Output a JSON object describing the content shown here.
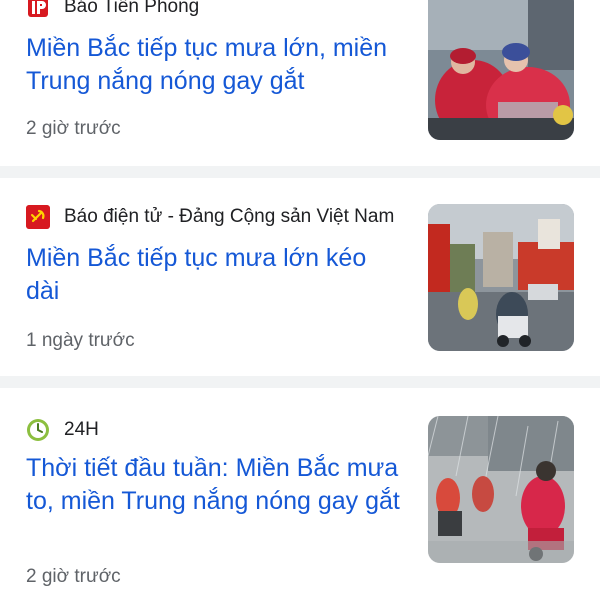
{
  "articles": [
    {
      "source": "Báo Tiền Phong",
      "title": "Miền Bắc tiếp tục mưa lớn, miền Trung nắng nóng gay gắt",
      "time": "2 giờ trước"
    },
    {
      "source": "Báo điện tử - Đảng Cộng sản Việt Nam",
      "title": "Miền Bắc tiếp tục mưa lớn kéo dài",
      "time": "1 ngày trước"
    },
    {
      "source": "24H",
      "title": "Thời tiết đầu tuần: Miền Bắc mưa to, miền Trung nắng nóng gay gắt",
      "time": "2 giờ trước"
    }
  ],
  "icons": {
    "logo_1": "tien-phong-logo",
    "logo_2": "communist-party-flag-logo",
    "logo_3": "24h-clock-logo"
  },
  "colors": {
    "headline": "#1558d6",
    "meta": "#5f6368",
    "separator": "#f1f3f4"
  }
}
